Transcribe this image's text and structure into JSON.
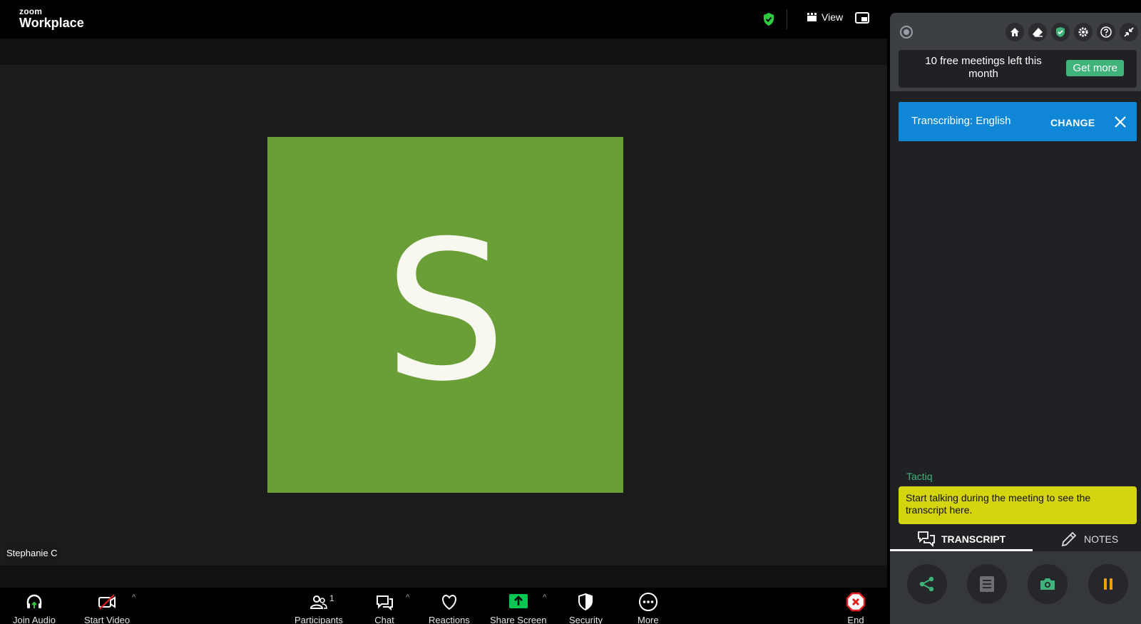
{
  "app": {
    "logo_small": "zoom",
    "logo_big": "Workplace"
  },
  "topbar": {
    "view_label": "View"
  },
  "participant": {
    "initial": "S",
    "name": "Stephanie C",
    "avatar_color": "#6a9f37"
  },
  "toolbar": {
    "join_audio": "Join Audio",
    "start_video": "Start Video",
    "participants": "Participants",
    "participants_count": "1",
    "chat": "Chat",
    "reactions": "Reactions",
    "share_screen": "Share Screen",
    "security": "Security",
    "more": "More",
    "end": "End",
    "share_color": "#00c853",
    "end_color": "#e02020"
  },
  "tactiq": {
    "free_meetings_text": "10 free meetings left this month",
    "get_more_label": "Get more",
    "transcribing_label": "Transcribing: English",
    "change_label": "CHANGE",
    "brand": "Tactiq",
    "hint": "Start talking during the meeting to see the transcript here.",
    "tab_transcript": "TRANSCRIPT",
    "tab_notes": "NOTES",
    "accent_green": "#3fb37a",
    "transcribe_blue": "#0f86d6",
    "hint_yellow": "#d4d40f",
    "pause_orange": "#f59e0b"
  }
}
